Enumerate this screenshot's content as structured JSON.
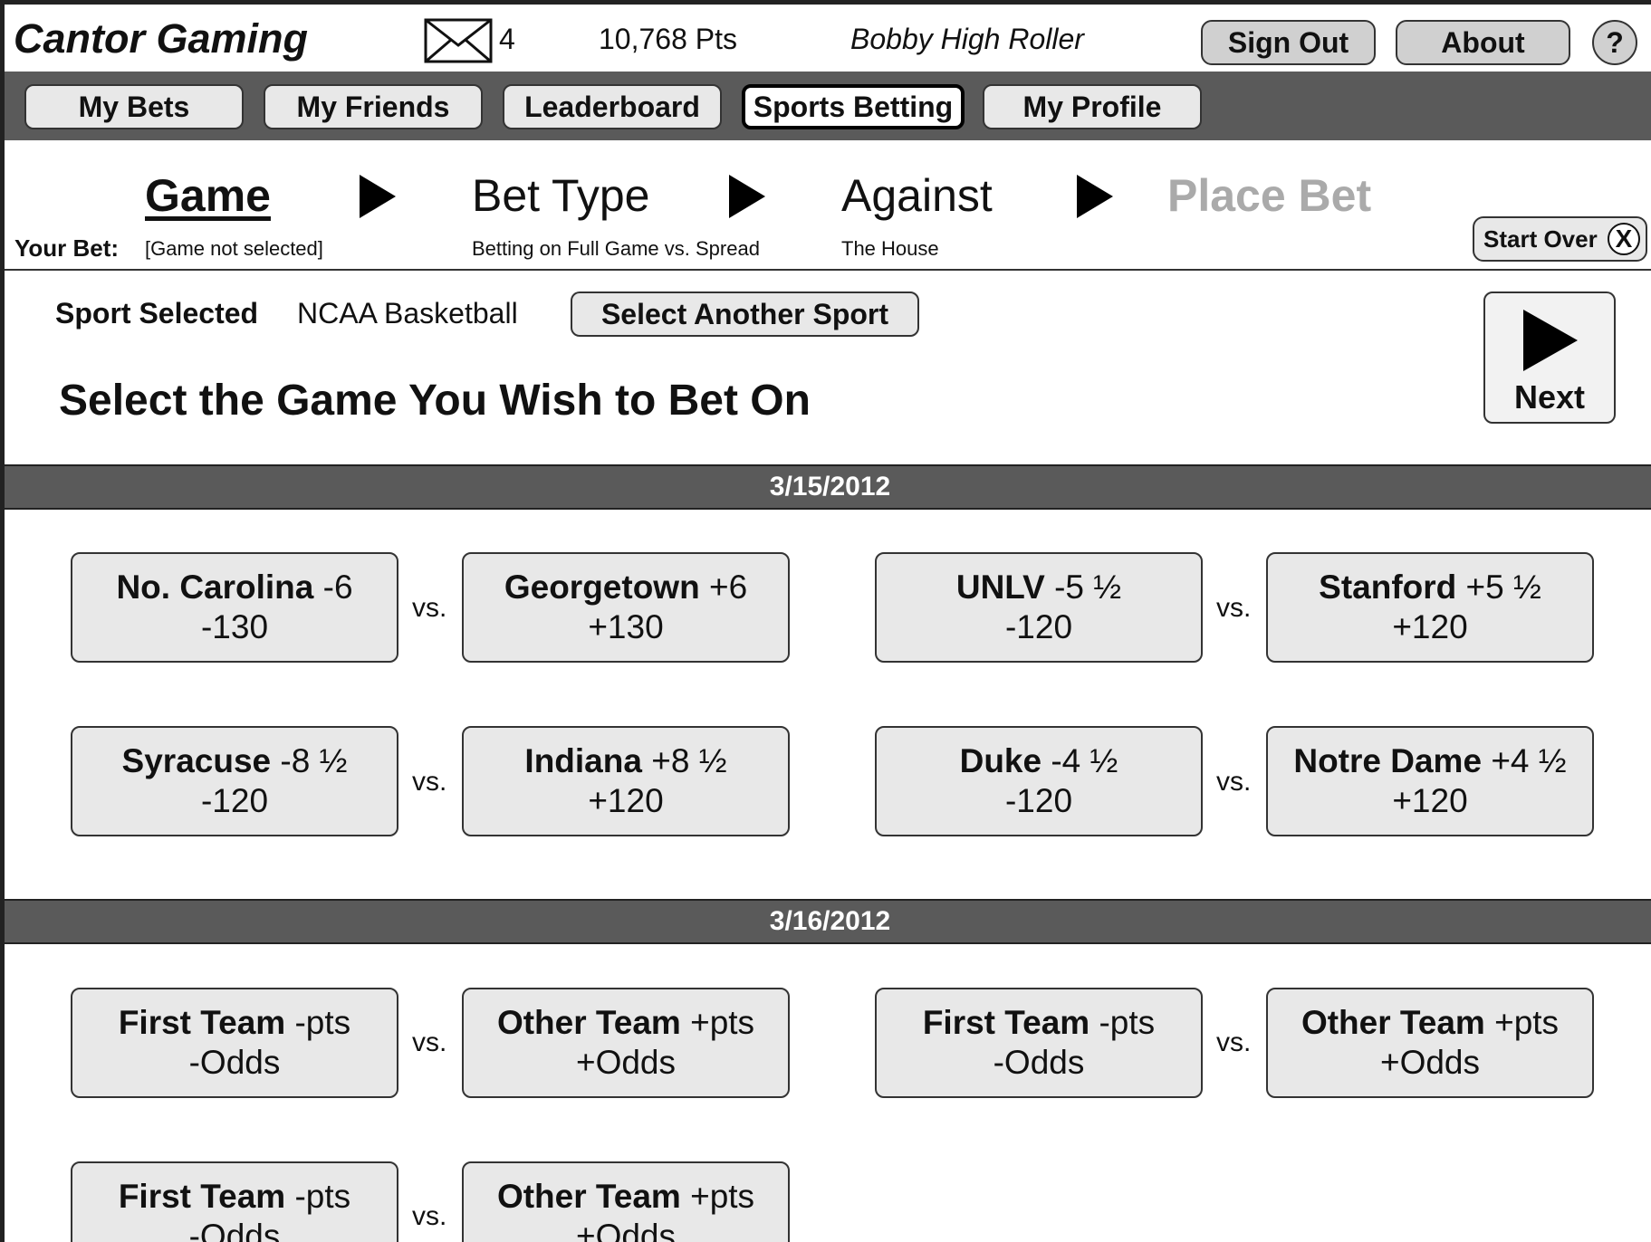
{
  "header": {
    "brand": "Cantor Gaming",
    "mail_count": "4",
    "points": "10,768 Pts",
    "user": "Bobby High Roller",
    "sign_out": "Sign Out",
    "about": "About",
    "help": "?"
  },
  "nav": {
    "items": [
      "My Bets",
      "My Friends",
      "Leaderboard",
      "Sports Betting",
      "My Profile"
    ],
    "active": "Sports Betting"
  },
  "wizard": {
    "steps": [
      "Game",
      "Bet Type",
      "Against",
      "Place Bet"
    ],
    "your_bet_label": "Your Bet:",
    "game_sub": "[Game not selected]",
    "bettype_sub": "Betting on Full Game vs. Spread",
    "against_sub": "The House",
    "start_over": "Start Over",
    "start_over_icon": "X"
  },
  "sport": {
    "label": "Sport Selected",
    "value": "NCAA Basketball",
    "select_another": "Select Another Sport"
  },
  "heading": "Select the Game You Wish to Bet On",
  "next_label": "Next",
  "vs_label": "vs.",
  "days": [
    {
      "date": "3/15/2012",
      "games": [
        {
          "home": {
            "name": "No. Carolina",
            "line": "-6",
            "odds": "-130"
          },
          "away": {
            "name": "Georgetown",
            "line": "+6",
            "odds": "+130"
          }
        },
        {
          "home": {
            "name": "UNLV",
            "line": "-5 ½",
            "odds": "-120"
          },
          "away": {
            "name": "Stanford",
            "line": "+5 ½",
            "odds": "+120"
          }
        },
        {
          "home": {
            "name": "Syracuse",
            "line": "-8 ½",
            "odds": "-120"
          },
          "away": {
            "name": "Indiana",
            "line": "+8 ½",
            "odds": "+120"
          }
        },
        {
          "home": {
            "name": "Duke",
            "line": "-4 ½",
            "odds": "-120"
          },
          "away": {
            "name": "Notre Dame",
            "line": "+4 ½",
            "odds": "+120"
          }
        }
      ]
    },
    {
      "date": "3/16/2012",
      "games": [
        {
          "home": {
            "name": "First Team",
            "line": "-pts",
            "odds": "-Odds"
          },
          "away": {
            "name": "Other Team",
            "line": "+pts",
            "odds": "+Odds"
          }
        },
        {
          "home": {
            "name": "First Team",
            "line": "-pts",
            "odds": "-Odds"
          },
          "away": {
            "name": "Other Team",
            "line": "+pts",
            "odds": "+Odds"
          }
        },
        {
          "home": {
            "name": "First Team",
            "line": "-pts",
            "odds": "-Odds"
          },
          "away": {
            "name": "Other Team",
            "line": "+pts",
            "odds": "+Odds"
          }
        }
      ]
    }
  ]
}
